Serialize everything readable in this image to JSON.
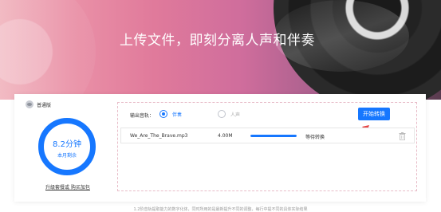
{
  "banner": {
    "title": "上传文件，即刻分离人声和伴奏"
  },
  "member": {
    "label": "普通版"
  },
  "quota": {
    "time": "8.2分钟",
    "subtitle": "本月剩余",
    "used_fraction": 0.9
  },
  "upgrade": {
    "label": "升级套餐或 购买加包"
  },
  "output": {
    "label": "输出音轨：",
    "options": [
      {
        "label": "伴奏",
        "selected": true
      },
      {
        "label": "人声",
        "selected": false
      }
    ]
  },
  "convert_button": {
    "label": "开始转换"
  },
  "file": {
    "name": "We_Are_The_Brave.mp3",
    "size": "4.00M",
    "progress": 1.0,
    "status": "等待转换"
  },
  "footer": {
    "note": "1.2阶音轨提取能力的数字化体，同时所用的是最新提升不同的调整，每行中提不同的具体实际结果"
  },
  "colors": {
    "accent": "#1677ff",
    "dashed_border": "#e8bcc8"
  },
  "icons": {
    "member": "user-icon",
    "delete": "trash-icon",
    "pointer": "arrow-icon"
  }
}
